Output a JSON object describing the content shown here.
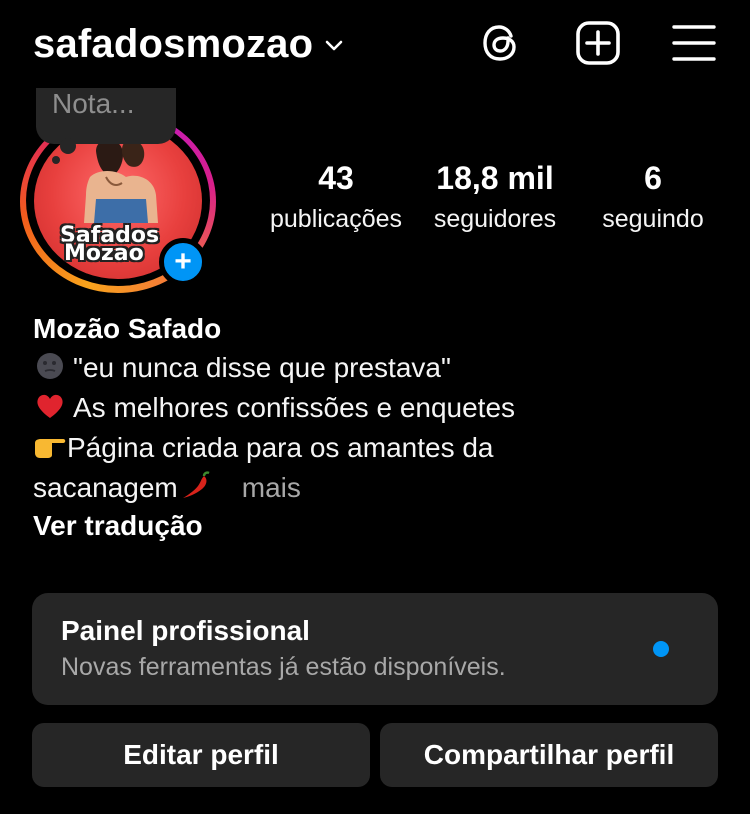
{
  "header": {
    "username": "safadosmozao",
    "icons": [
      "chevron-down-icon",
      "threads-icon",
      "add-content-icon",
      "menu-icon"
    ]
  },
  "note": {
    "placeholder": "Nota..."
  },
  "avatar": {
    "image_text_line1": "Safados",
    "image_text_line2": "Mozao",
    "add_badge": "+"
  },
  "stats": [
    {
      "value": "43",
      "label": "publicações"
    },
    {
      "value": "18,8 mil",
      "label": "seguidores"
    },
    {
      "value": "6",
      "label": "seguindo"
    }
  ],
  "bio": {
    "display_name": "Mozão Safado",
    "lines": [
      {
        "emoji": "new-moon-face-icon",
        "text": "\"eu nunca disse que prestava\""
      },
      {
        "emoji": "red-heart-icon",
        "text": "As melhores confissões e enquetes"
      },
      {
        "emoji": "pointing-right-icon",
        "text": "Página criada para os amantes da"
      },
      {
        "text": "sacanagem",
        "emoji_after": "chili-pepper-icon",
        "more": "mais"
      }
    ],
    "translate": "Ver tradução"
  },
  "professional_panel": {
    "title": "Painel profissional",
    "subtitle": "Novas ferramentas já estão disponíveis.",
    "dot_color": "#0095f6"
  },
  "buttons": {
    "edit": "Editar perfil",
    "share": "Compartilhar perfil"
  },
  "colors": {
    "background": "#000000",
    "card": "#262626",
    "accent": "#0095f6",
    "muted": "#a8a8a8"
  }
}
